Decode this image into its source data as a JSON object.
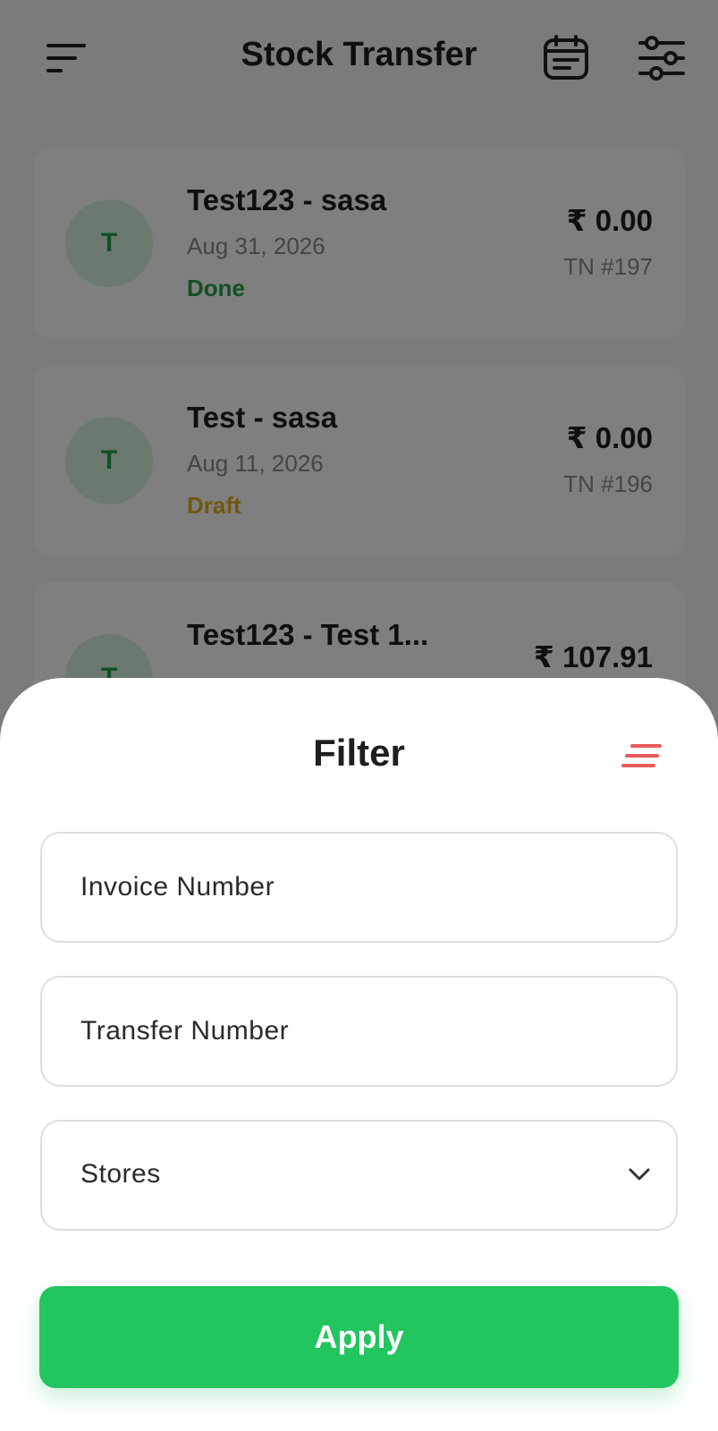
{
  "header": {
    "title": "Stock Transfer",
    "icons": {
      "menu": "menu-icon",
      "calendar": "calendar-icon",
      "settings": "sliders-icon"
    }
  },
  "transfers": [
    {
      "initial": "T",
      "name": "Test123 - sasa",
      "date": "Aug 31, 2026",
      "status": "Done",
      "amount": "₹ 0.00",
      "tn": "TN #197"
    },
    {
      "initial": "T",
      "name": "Test - sasa",
      "date": "Aug 11, 2026",
      "status": "Draft",
      "amount": "₹ 0.00",
      "tn": "TN #196"
    },
    {
      "initial": "T",
      "name": "Test123 - Test 1...",
      "date": "",
      "status": "",
      "amount": "₹ 107.91",
      "tn": ""
    }
  ],
  "filter": {
    "title": "Filter",
    "invoice_placeholder": "Invoice Number",
    "transfer_placeholder": "Transfer Number",
    "stores_label": "Stores",
    "apply_label": "Apply"
  },
  "colors": {
    "accent_green": "#22c55e",
    "done_status": "#22a24a",
    "draft_status": "#e0b020",
    "clear_filter_icon": "#e85a5a"
  }
}
